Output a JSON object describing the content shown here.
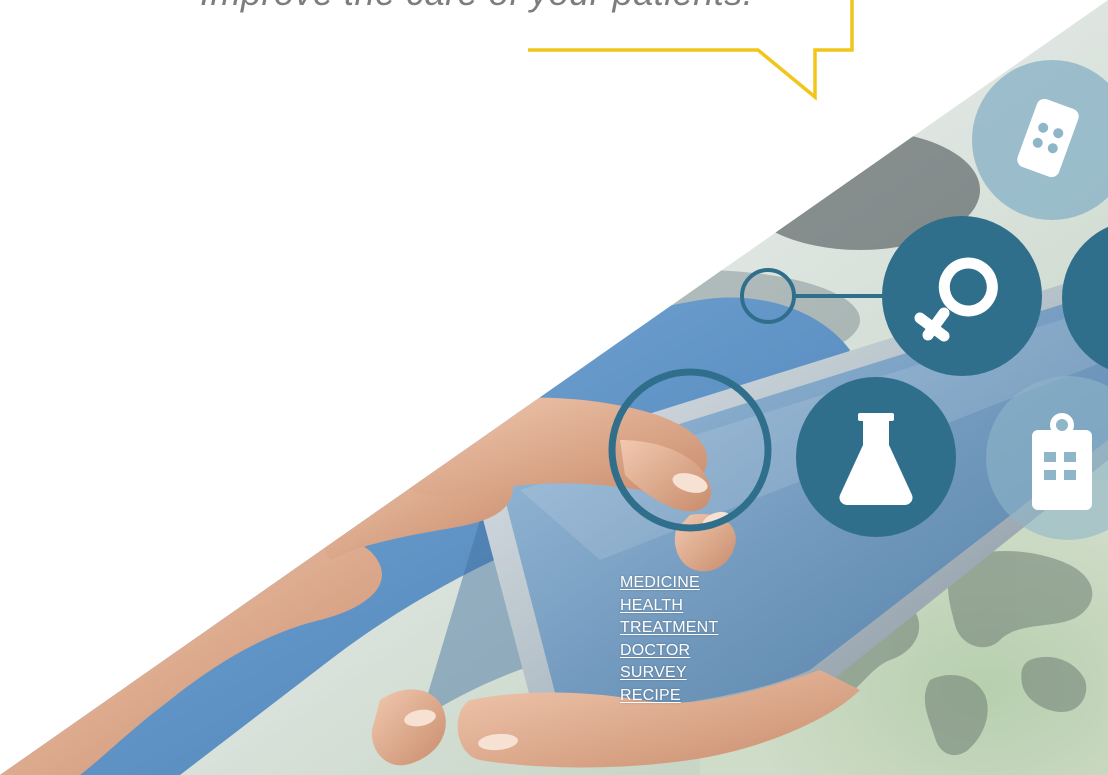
{
  "hero": {
    "tagline": "Improve the care of your patients.",
    "words": [
      "MEDICINE",
      "HEALTH",
      "TREATMENT",
      "DOCTOR",
      "SURVEY",
      "RECIPE"
    ],
    "icons": [
      "phone-icon",
      "female-icon",
      "flask-icon",
      "clipboard-icon",
      "ring-connector-icon",
      "outline-ring-icon"
    ],
    "colors": {
      "callout_border": "#f2c51b",
      "icon_circle": "#2f6f8c",
      "icon_circle_light": "#8fb6c8",
      "scrub_blue": "#6e9fcf"
    }
  }
}
